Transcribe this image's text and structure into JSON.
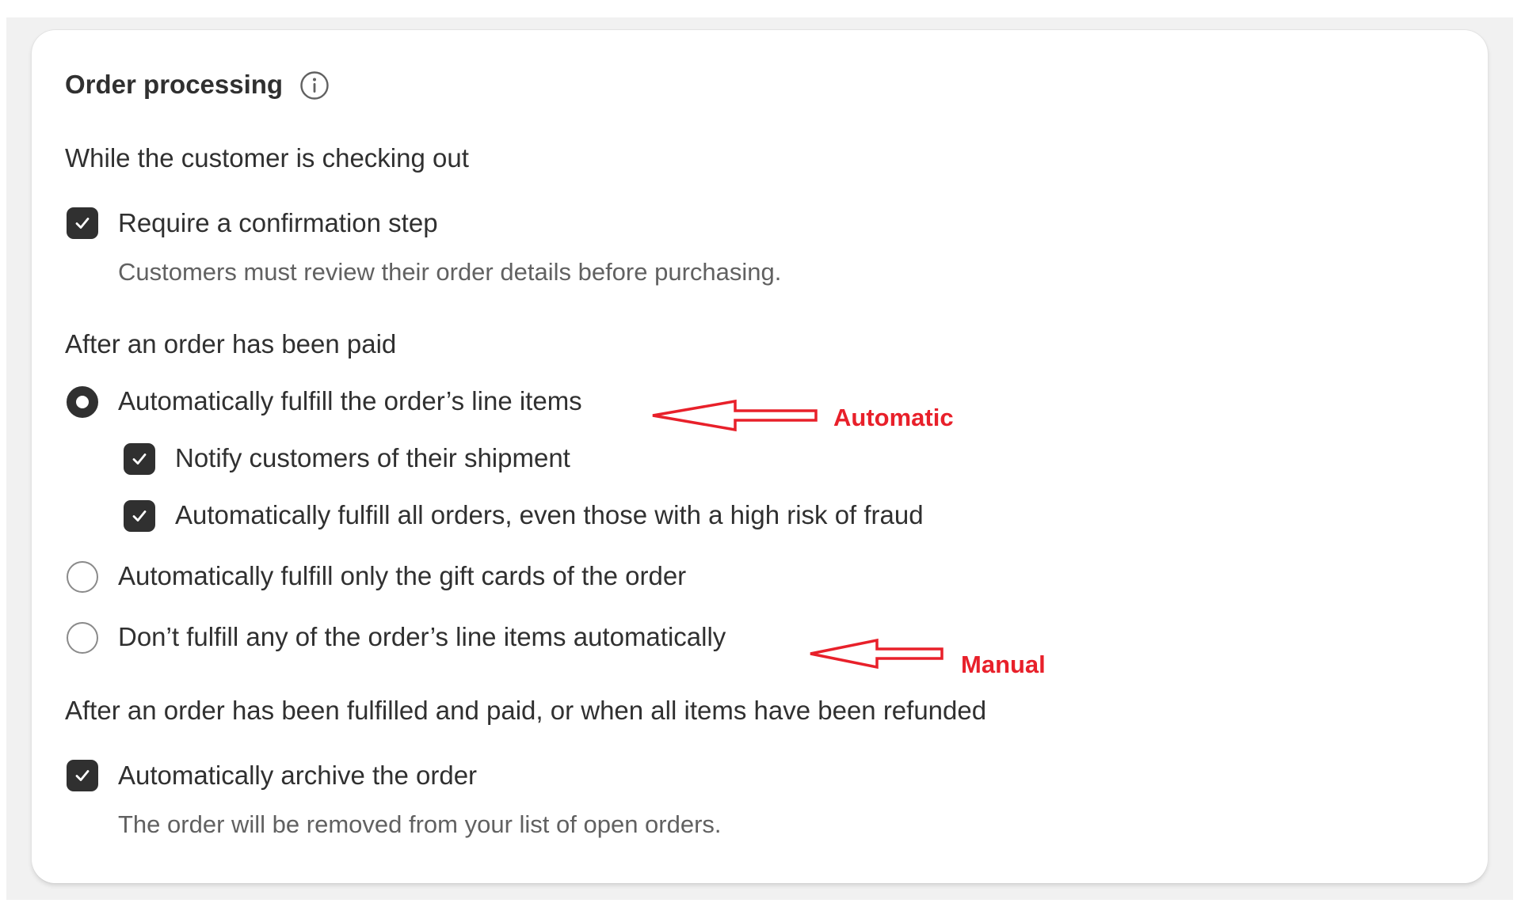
{
  "card": {
    "title": "Order processing",
    "info_icon": "info-circle-icon"
  },
  "checkout": {
    "heading": "While the customer is checking out",
    "confirmation": {
      "label": "Require a confirmation step",
      "checked": true,
      "help": "Customers must review their order details before purchasing."
    }
  },
  "after_paid": {
    "heading": "After an order has been paid",
    "options": [
      {
        "label": "Automatically fulfill the order’s line items",
        "selected": true
      },
      {
        "label": "Automatically fulfill only the gift cards of the order",
        "selected": false
      },
      {
        "label": "Don’t fulfill any of the order’s line items automatically",
        "selected": false
      }
    ],
    "sub_options": [
      {
        "label": "Notify customers of their shipment",
        "checked": true
      },
      {
        "label": "Automatically fulfill all orders, even those with a high risk of fraud",
        "checked": true
      }
    ]
  },
  "after_fulfilled": {
    "heading": "After an order has been fulfilled and paid, or when all items have been refunded",
    "archive": {
      "label": "Automatically archive the order",
      "checked": true,
      "help": "The order will be removed from your list of open orders."
    }
  },
  "annotations": {
    "automatic": "Automatic",
    "manual": "Manual",
    "color": "#e8202a"
  }
}
